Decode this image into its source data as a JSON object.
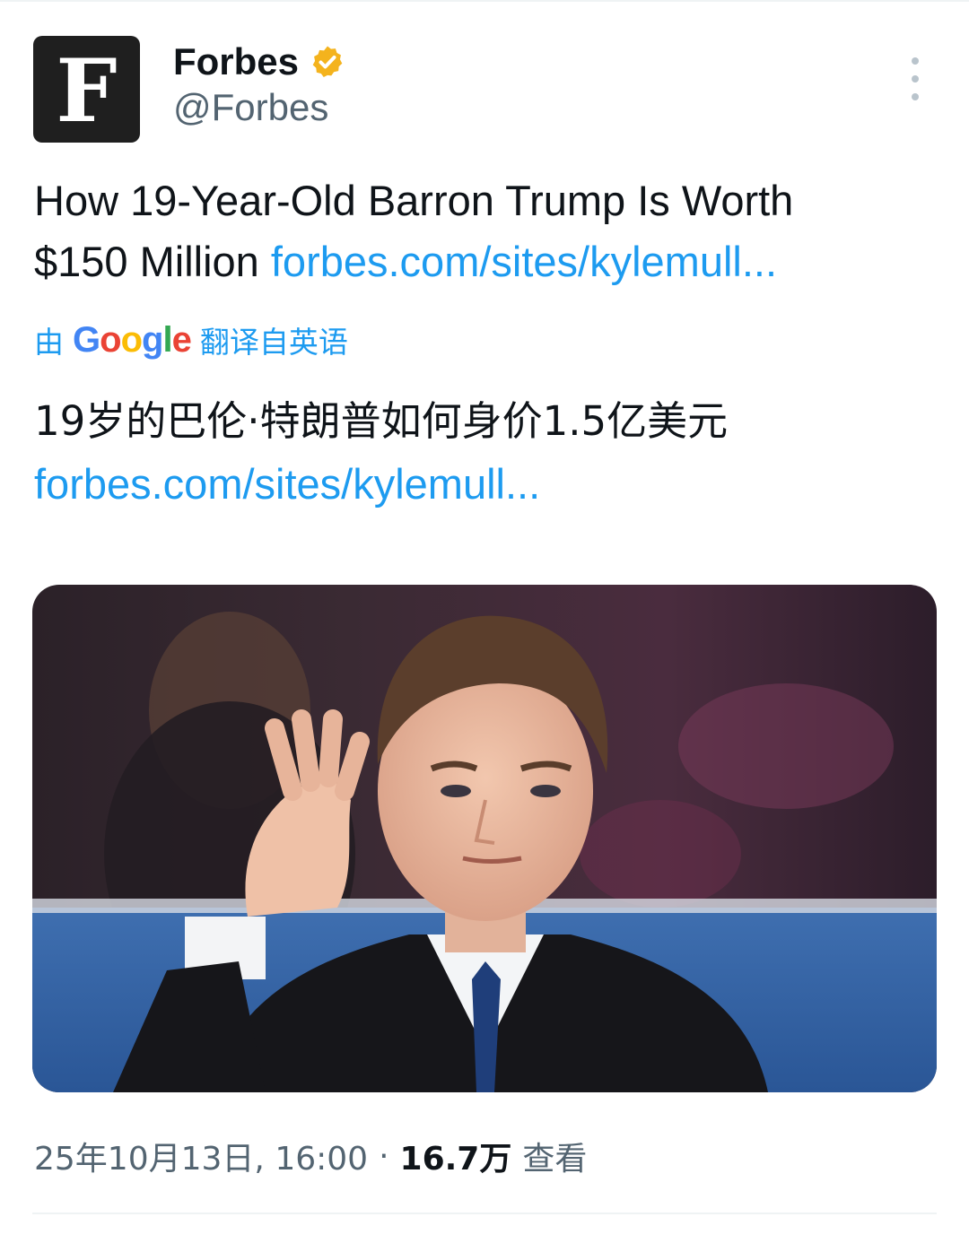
{
  "author": {
    "avatar_letter": "F",
    "display_name": "Forbes",
    "handle": "@Forbes",
    "verified": true,
    "badge_color": "#f4b31d"
  },
  "tweet": {
    "text_line1": "How 19-Year-Old Barron Trump Is Worth",
    "text_line2_prefix": "$150 Million ",
    "link": "forbes.com/sites/kylemull..."
  },
  "translation": {
    "prefix": "由",
    "service": "Google",
    "suffix": "翻译自英语",
    "translated_text": "19岁的巴伦·特朗普如何身价1.5亿美元",
    "link": "forbes.com/sites/kylemull..."
  },
  "media": {
    "type": "photo"
  },
  "meta": {
    "timestamp": "25年10月13日, 16:00",
    "separator": "·",
    "views_count": "16.7万",
    "views_label": "查看"
  },
  "colors": {
    "link": "#1d9bf0",
    "secondary_text": "#536471",
    "primary_text": "#0f1419"
  }
}
